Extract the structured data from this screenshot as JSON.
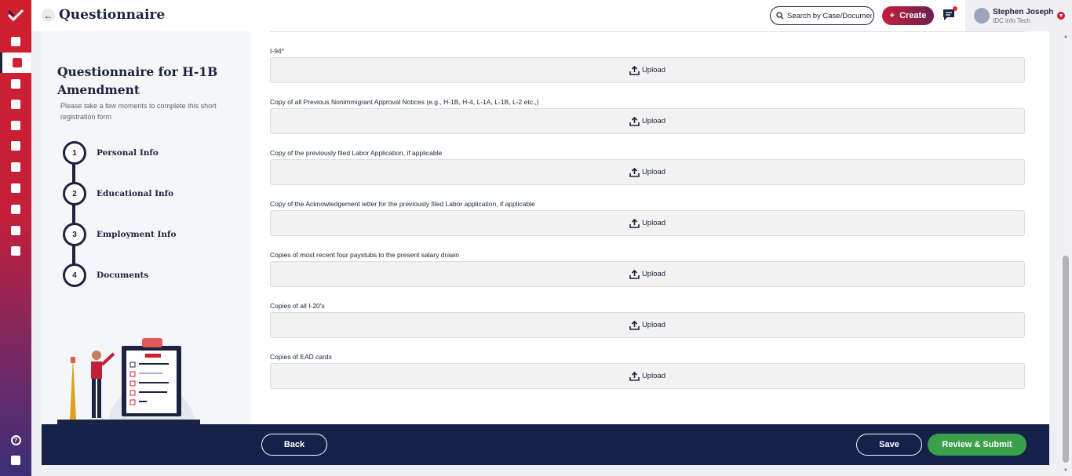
{
  "header": {
    "back_icon": "arrow-left-icon",
    "title": "Questionnaire",
    "search_placeholder": "Search by Case/Documen",
    "create_label": "Create",
    "user": {
      "name": "Stephen Joseph",
      "org": "IDC info Tech"
    }
  },
  "sidebar": {
    "items": [
      {
        "icon": "dashboard-icon",
        "active": false
      },
      {
        "icon": "document-icon",
        "active": true
      },
      {
        "icon": "file-edit-icon",
        "active": false
      },
      {
        "icon": "chat-icon",
        "active": false
      },
      {
        "icon": "book-icon",
        "active": false
      },
      {
        "icon": "form-icon",
        "active": false
      },
      {
        "icon": "building-icon",
        "active": false
      },
      {
        "icon": "user-icon",
        "active": false
      },
      {
        "icon": "notes-icon",
        "active": false
      },
      {
        "icon": "person-icon",
        "active": false
      },
      {
        "icon": "group-icon",
        "active": false
      }
    ],
    "bottom": [
      {
        "icon": "help-icon"
      },
      {
        "icon": "guide-icon"
      }
    ]
  },
  "questionnaire": {
    "title": "Questionnaire for H-1B Amendment",
    "description": "Please take a few moments to complete this short registration form",
    "steps": [
      {
        "num": "1",
        "label": "Personal Info"
      },
      {
        "num": "2",
        "label": "Educational Info"
      },
      {
        "num": "3",
        "label": "Employment Info"
      },
      {
        "num": "4",
        "label": "Documents"
      }
    ]
  },
  "documents": {
    "upload_label": "Upload",
    "fields": [
      {
        "label": "I-94*"
      },
      {
        "label": "Copy of all Previous Nonimmigrant Approval Notices (e.g., H-1B, H-4, L-1A, L-1B, L-2 etc.,)"
      },
      {
        "label": "Copy of the previously filed Labor Application, if applicable"
      },
      {
        "label": "Copy of the Acknowledgement letter for the previously filed Labor application, if applicable"
      },
      {
        "label": "Copies of most recent four paystubs to the present salary drawn"
      },
      {
        "label": "Copies of all I-20's"
      },
      {
        "label": "Copies of EAD cards"
      }
    ]
  },
  "footer": {
    "back": "Back",
    "save": "Save",
    "submit": "Review & Submit"
  },
  "colors": {
    "brand_red": "#d0202f",
    "navy": "#16214a",
    "green": "#3aa04a"
  }
}
